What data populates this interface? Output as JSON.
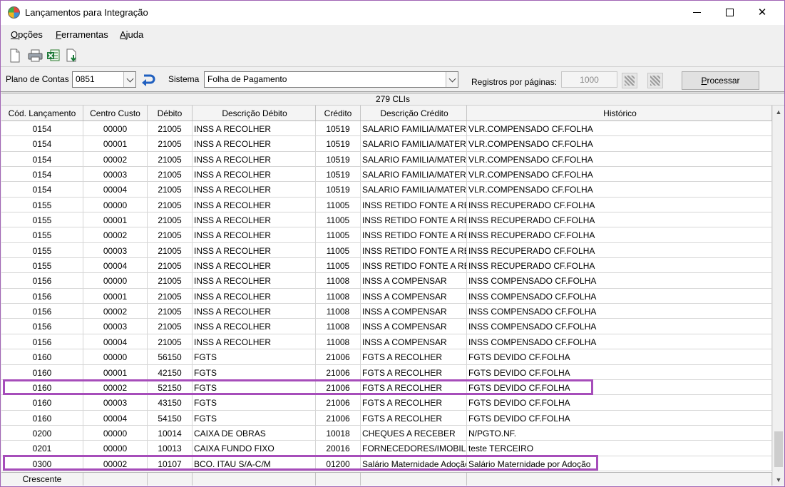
{
  "window": {
    "title": "Lançamentos para Integração",
    "minimize_icon": "minimize-icon",
    "maximize_icon": "maximize-icon",
    "close_glyph": "✕"
  },
  "menu": {
    "opcoes": {
      "u": "O",
      "rest": "pções"
    },
    "ferramentas": {
      "u": "F",
      "rest": "erramentas"
    },
    "ajuda": {
      "u": "A",
      "rest": "juda"
    }
  },
  "toolbar": {
    "icons": [
      "new-document-icon",
      "print-icon",
      "export-excel-icon",
      "download-icon"
    ]
  },
  "filters": {
    "plano_label": "Plano de Contas",
    "plano_value": "0851",
    "sistema_label": "Sistema",
    "sistema_value": "Folha de Pagamento",
    "registros_label": "Registros por páginas:",
    "registros_value": "1000",
    "processar_u": "P",
    "processar_rest": "rocessar"
  },
  "grid": {
    "count_label": "279 CLIs",
    "columns": [
      "Cód. Lançamento",
      "Centro Custo",
      "Débito",
      "Descrição Débito",
      "Crédito",
      "Descrição Crédito",
      "Histórico"
    ],
    "rows": [
      [
        "0154",
        "00000",
        "21005",
        "INSS A RECOLHER",
        "10519",
        "SALARIO FAMILIA/MATERI",
        "VLR.COMPENSADO CF.FOLHA"
      ],
      [
        "0154",
        "00001",
        "21005",
        "INSS A RECOLHER",
        "10519",
        "SALARIO FAMILIA/MATERI",
        "VLR.COMPENSADO CF.FOLHA"
      ],
      [
        "0154",
        "00002",
        "21005",
        "INSS A RECOLHER",
        "10519",
        "SALARIO FAMILIA/MATERI",
        "VLR.COMPENSADO CF.FOLHA"
      ],
      [
        "0154",
        "00003",
        "21005",
        "INSS A RECOLHER",
        "10519",
        "SALARIO FAMILIA/MATERI",
        "VLR.COMPENSADO CF.FOLHA"
      ],
      [
        "0154",
        "00004",
        "21005",
        "INSS A RECOLHER",
        "10519",
        "SALARIO FAMILIA/MATERI",
        "VLR.COMPENSADO CF.FOLHA"
      ],
      [
        "0155",
        "00000",
        "21005",
        "INSS A RECOLHER",
        "11005",
        "INSS RETIDO FONTE A REC",
        "INSS RECUPERADO CF.FOLHA"
      ],
      [
        "0155",
        "00001",
        "21005",
        "INSS A RECOLHER",
        "11005",
        "INSS RETIDO FONTE A REC",
        "INSS RECUPERADO CF.FOLHA"
      ],
      [
        "0155",
        "00002",
        "21005",
        "INSS A RECOLHER",
        "11005",
        "INSS RETIDO FONTE A REC",
        "INSS RECUPERADO CF.FOLHA"
      ],
      [
        "0155",
        "00003",
        "21005",
        "INSS A RECOLHER",
        "11005",
        "INSS RETIDO FONTE A REC",
        "INSS RECUPERADO CF.FOLHA"
      ],
      [
        "0155",
        "00004",
        "21005",
        "INSS A RECOLHER",
        "11005",
        "INSS RETIDO FONTE A REC",
        "INSS RECUPERADO CF.FOLHA"
      ],
      [
        "0156",
        "00000",
        "21005",
        "INSS A RECOLHER",
        "11008",
        "INSS A COMPENSAR",
        "INSS COMPENSADO CF.FOLHA"
      ],
      [
        "0156",
        "00001",
        "21005",
        "INSS A RECOLHER",
        "11008",
        "INSS A COMPENSAR",
        "INSS COMPENSADO CF.FOLHA"
      ],
      [
        "0156",
        "00002",
        "21005",
        "INSS A RECOLHER",
        "11008",
        "INSS A COMPENSAR",
        "INSS COMPENSADO CF.FOLHA"
      ],
      [
        "0156",
        "00003",
        "21005",
        "INSS A RECOLHER",
        "11008",
        "INSS A COMPENSAR",
        "INSS COMPENSADO CF.FOLHA"
      ],
      [
        "0156",
        "00004",
        "21005",
        "INSS A RECOLHER",
        "11008",
        "INSS A COMPENSAR",
        "INSS COMPENSADO CF.FOLHA"
      ],
      [
        "0160",
        "00000",
        "56150",
        "FGTS",
        "21006",
        "FGTS A RECOLHER",
        "FGTS DEVIDO CF.FOLHA"
      ],
      [
        "0160",
        "00001",
        "42150",
        "FGTS",
        "21006",
        "FGTS A RECOLHER",
        "FGTS DEVIDO CF.FOLHA"
      ],
      [
        "0160",
        "00002",
        "52150",
        "FGTS",
        "21006",
        "FGTS A RECOLHER",
        "FGTS DEVIDO CF.FOLHA"
      ],
      [
        "0160",
        "00003",
        "43150",
        "FGTS",
        "21006",
        "FGTS A RECOLHER",
        "FGTS DEVIDO CF.FOLHA"
      ],
      [
        "0160",
        "00004",
        "54150",
        "FGTS",
        "21006",
        "FGTS A RECOLHER",
        "FGTS DEVIDO CF.FOLHA"
      ],
      [
        "0200",
        "00000",
        "10014",
        "CAIXA DE OBRAS",
        "10018",
        "CHEQUES A RECEBER",
        "N/PGTO.NF."
      ],
      [
        "0201",
        "00000",
        "10013",
        "CAIXA FUNDO FIXO",
        "20016",
        "FORNECEDORES/IMOBILIZ",
        "teste TERCEIRO"
      ],
      [
        "0300",
        "00002",
        "10107",
        "BCO. ITAU S/A-C/M",
        "01200",
        "Salário Maternidade Adoção",
        "Salário Maternidade por Adoção"
      ]
    ],
    "footer_label": "Crescente"
  },
  "colors": {
    "highlight": "#a64dba"
  }
}
